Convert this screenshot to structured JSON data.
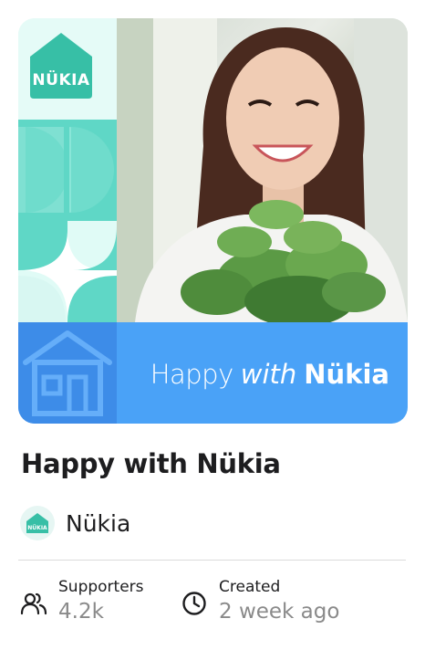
{
  "card": {
    "logo_text": "NÜKIA",
    "banner": {
      "word1": "Happy",
      "word2": "with",
      "word3": "Nükia"
    }
  },
  "title": "Happy with Nükia",
  "creator": {
    "avatar_text": "NÜKIA",
    "name": "Nükia"
  },
  "stats": {
    "supporters": {
      "label": "Supporters",
      "value": "4.2k",
      "icon": "people-icon"
    },
    "created": {
      "label": "Created",
      "value": "2 week ago",
      "icon": "clock-icon"
    }
  },
  "colors": {
    "teal": "#5fd7c6",
    "logo_teal": "#37bfa6",
    "banner_blue": "#4aa2f7",
    "banner_house_blue": "#3d8ce8"
  }
}
